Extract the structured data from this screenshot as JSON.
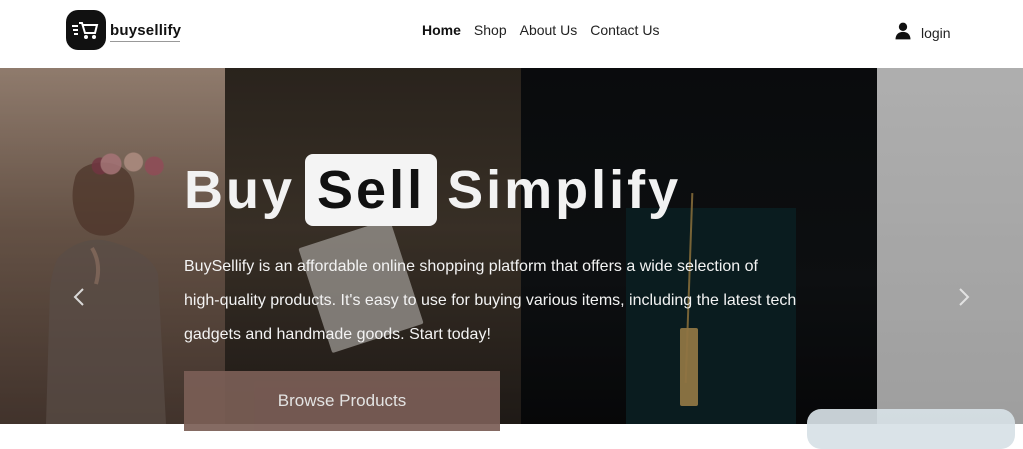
{
  "brand": {
    "name": "buysellify",
    "logo_icon": "shopping-cart-icon"
  },
  "nav": {
    "items": [
      {
        "label": "Home",
        "active": true
      },
      {
        "label": "Shop",
        "active": false
      },
      {
        "label": "About Us",
        "active": false
      },
      {
        "label": "Contact Us",
        "active": false
      }
    ]
  },
  "auth": {
    "login_label": "login",
    "user_icon": "user-icon"
  },
  "hero": {
    "title_parts": [
      "Buy",
      "Sell",
      "Simplify"
    ],
    "description_lines": [
      "BuySellify is an affordable online shopping platform that offers a wide selection of",
      "high-quality products. It's easy to use for buying various items, including the latest tech",
      "gadgets and handmade goods. Start today!"
    ],
    "cta_label": "Browse Products",
    "carousel_prev_icon": "chevron-left-icon",
    "carousel_next_icon": "chevron-right-icon"
  },
  "colors": {
    "text_dark": "#111111",
    "hero_text": "#f2f2f2",
    "cta_bg": "#7b5e56",
    "sell_pill_bg": "#f4f4f4"
  }
}
